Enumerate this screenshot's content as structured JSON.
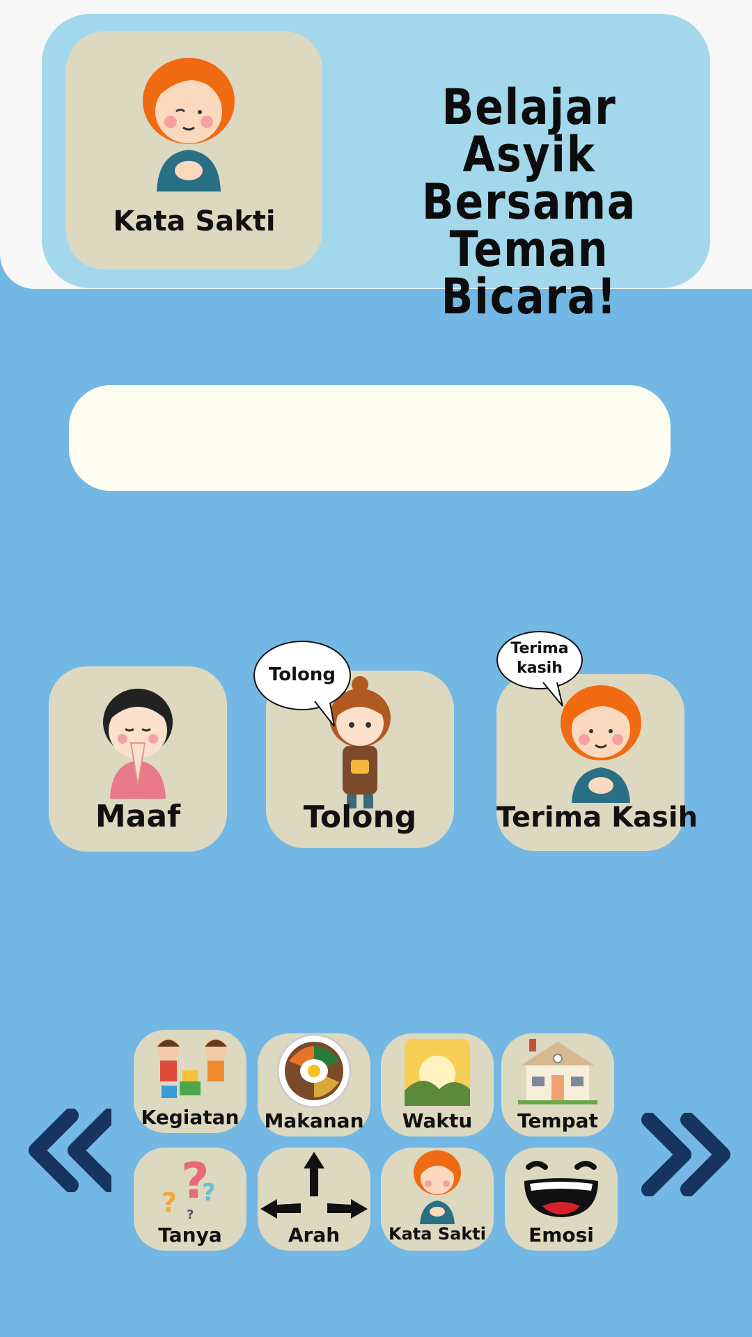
{
  "header": {
    "tile_label": "Kata Sakti",
    "title_line1": "Belajar Asyik",
    "title_line2": "Bersama",
    "title_line3": "Teman Bicara!"
  },
  "sentence_box": {
    "text": ""
  },
  "cards": {
    "maaf": {
      "label": "Maaf"
    },
    "tolong": {
      "label": "Tolong",
      "bubble": "Tolong"
    },
    "terima_kasih": {
      "label": "Terima Kasih",
      "bubble_line1": "Terima",
      "bubble_line2": "kasih"
    }
  },
  "categories": {
    "row1": [
      "Kegiatan",
      "Makanan",
      "Waktu",
      "Tempat"
    ],
    "row2": [
      "Tanya",
      "Arah",
      "Kata Sakti",
      "Emosi"
    ]
  },
  "colors": {
    "background": "#73b8e4",
    "header_card": "#a3d8ec",
    "tile": "#ddd8c0",
    "nav_arrow": "#17335f"
  },
  "icons": {
    "prev": "double-chevron-left-icon",
    "next": "double-chevron-right-icon"
  }
}
